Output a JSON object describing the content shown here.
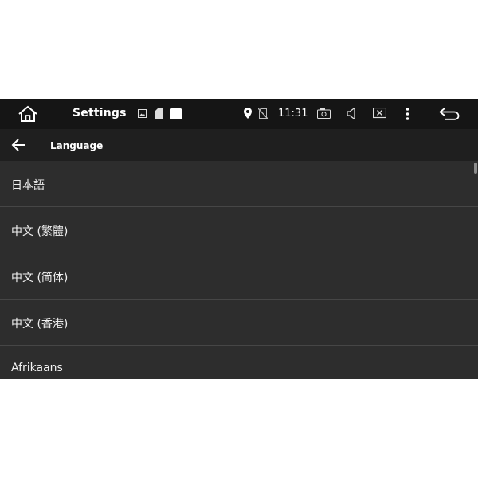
{
  "status_bar": {
    "title": "Settings",
    "time": "11:31",
    "icons": [
      "home-icon",
      "image-icon",
      "sd-card-icon",
      "square-icon",
      "location-pin-icon",
      "no-sim-icon",
      "screenshot-icon",
      "volume-icon",
      "close-box-icon",
      "more-vert-icon",
      "back-arrow-icon"
    ]
  },
  "app_bar": {
    "title": "Language",
    "back_icon": "arrow-left-icon"
  },
  "languages": [
    "日本語",
    "中文 (繁體)",
    "中文 (简体)",
    "中文 (香港)",
    "Afrikaans"
  ],
  "colors": {
    "status_bar_bg": "#151515",
    "app_bar_bg": "#1f1f1f",
    "list_bg": "#2d2d2d",
    "divider": "#464646",
    "text": "#ffffff"
  }
}
